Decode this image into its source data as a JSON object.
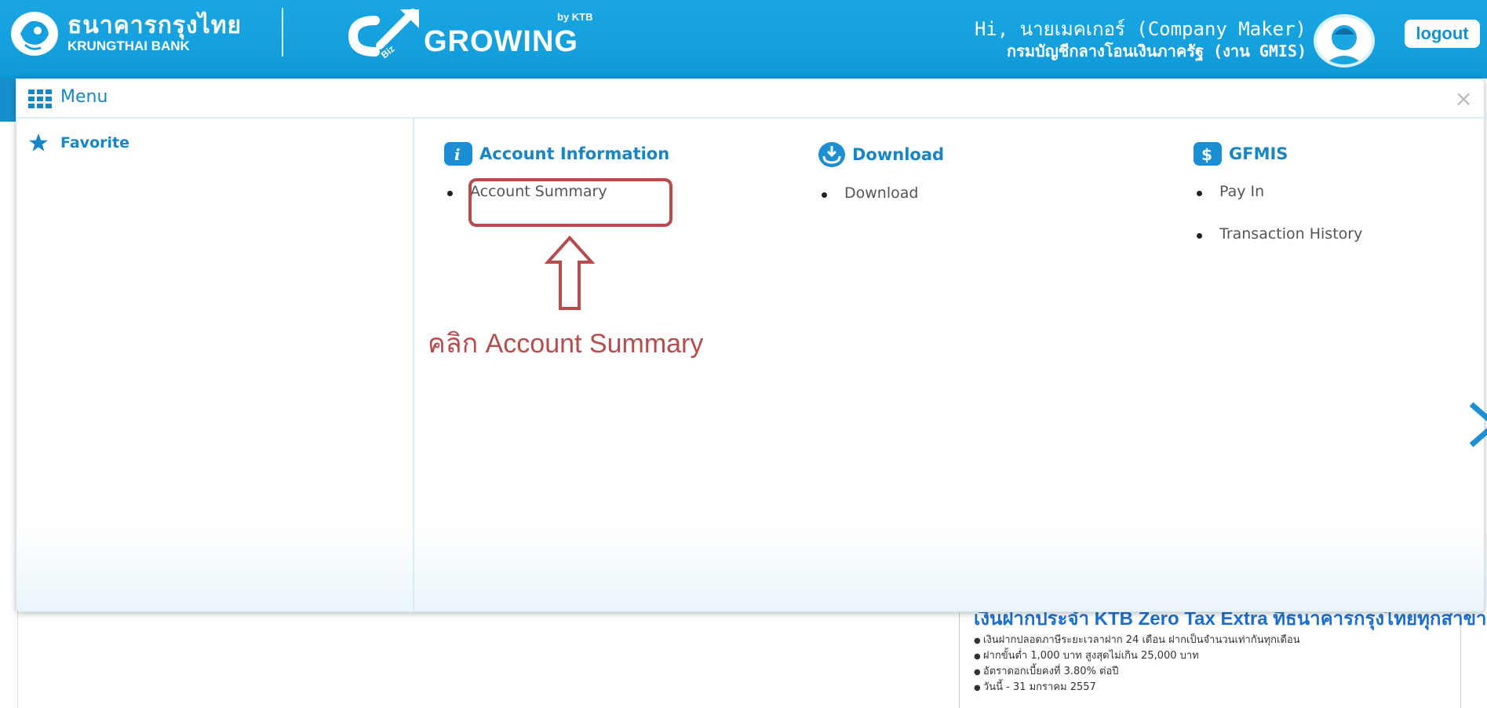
{
  "header": {
    "bank_name_thai": "ธนาคารกรุงไทย",
    "bank_name_eng": "KRUNGTHAI BANK",
    "product_name": "GROWING",
    "product_prefix": "Biz",
    "product_by": "by KTB",
    "greeting": "Hi, นายเมคเกอร์ (Company Maker)",
    "department": "กรมบัญชีกลางโอนเงินภาครัฐ (งาน GMIS)",
    "logout_label": "logout"
  },
  "menu": {
    "title": "Menu",
    "close_symbol": "×",
    "favorite_label": "Favorite",
    "sections": [
      {
        "title": "Account Information",
        "icon": "info-icon",
        "items": [
          "Account Summary"
        ]
      },
      {
        "title": "Download",
        "icon": "download-icon",
        "items": [
          "Download"
        ]
      },
      {
        "title": "GFMIS",
        "icon": "dollar-icon",
        "items": [
          "Pay In",
          "Transaction History"
        ]
      }
    ]
  },
  "annotation": {
    "text": "คลิก Account Summary",
    "color": "#b84c4c"
  },
  "promo": {
    "title": "เงินฝากประจำ KTB Zero Tax Extra ที่ธนาคารกรุงไทยทุกสาขา",
    "bullets": [
      "เงินฝากปลอดภาษีระยะเวลาฝาก 24 เดือน ฝากเป็นจำนวนเท่ากันทุกเดือน",
      "ฝากขั้นต่ำ 1,000 บาท สูงสุดไม่เกิน 25,000 บาท",
      "อัตราดอกเบี้ยคงที่ 3.80% ต่อปี",
      "วันนี้ - 31 มกราคม 2557"
    ]
  },
  "colors": {
    "header_blue": "#14a0de",
    "accent_blue": "#1586c6",
    "highlight_red": "#b84c4c"
  }
}
